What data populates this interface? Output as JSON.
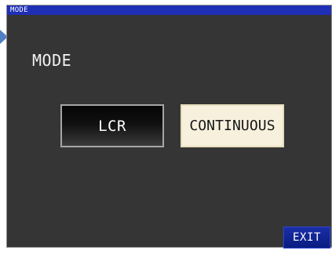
{
  "window": {
    "title": "MODE"
  },
  "main": {
    "heading": "MODE",
    "buttons": {
      "lcr_label": "LCR",
      "continuous_label": "CONTINUOUS"
    }
  },
  "footer": {
    "exit_label": "EXIT"
  },
  "colors": {
    "titlebar": "#1f2fb6",
    "screen_bg": "#353535",
    "selected_button_bg": "#f6f0dd",
    "exit_button_bg": "#0a1b7f",
    "pointer": "#4f7fc4"
  },
  "icons": {
    "pointer": "triangle-pointer-icon"
  }
}
